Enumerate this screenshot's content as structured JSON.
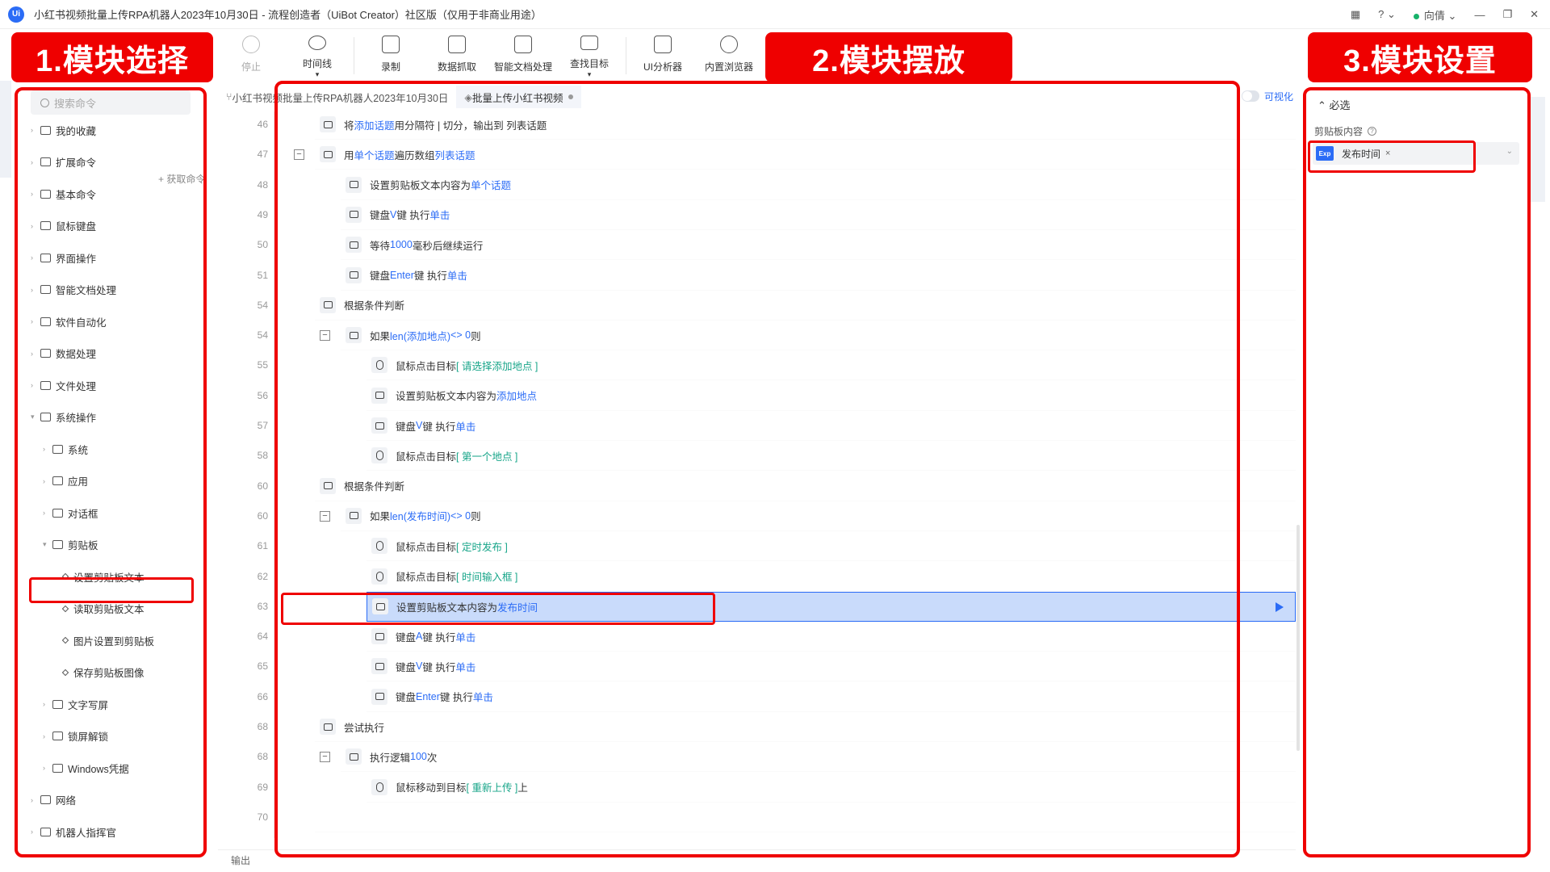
{
  "window": {
    "logo": "Ui",
    "title": "小红书视频批量上传RPA机器人2023年10月30日 - 流程创造者（UiBot Creator）社区版（仅用于非商业用途）",
    "user": "向倩"
  },
  "toolbar": [
    {
      "label": "停止",
      "icon": "stop-icon",
      "disabled": true
    },
    {
      "label": "时间线",
      "icon": "clock-icon",
      "dropdown": true
    },
    {
      "label": "录制",
      "icon": "record-icon"
    },
    {
      "label": "数据抓取",
      "icon": "data-grab-icon"
    },
    {
      "label": "智能文档处理",
      "icon": "ai-doc-icon"
    },
    {
      "label": "查找目标",
      "icon": "find-target-icon",
      "dropdown": true
    },
    {
      "label": "UI分析器",
      "icon": "ui-analyzer-icon"
    },
    {
      "label": "内置浏览器",
      "icon": "browser-icon"
    }
  ],
  "annotations": {
    "tag1": "1.模块选择",
    "tag2": "2.模块摆放",
    "tag3": "3.模块设置"
  },
  "left": {
    "search_placeholder": "搜索命令",
    "get_command": "+ 获取命令",
    "tree": [
      {
        "label": "我的收藏",
        "level": 0
      },
      {
        "label": "扩展命令",
        "level": 0
      },
      {
        "label": "基本命令",
        "level": 0
      },
      {
        "label": "鼠标键盘",
        "level": 0
      },
      {
        "label": "界面操作",
        "level": 0
      },
      {
        "label": "智能文档处理",
        "level": 0
      },
      {
        "label": "软件自动化",
        "level": 0
      },
      {
        "label": "数据处理",
        "level": 0
      },
      {
        "label": "文件处理",
        "level": 0
      },
      {
        "label": "系统操作",
        "level": 0,
        "expanded": true
      },
      {
        "label": "系统",
        "level": 1
      },
      {
        "label": "应用",
        "level": 1
      },
      {
        "label": "对话框",
        "level": 1
      },
      {
        "label": "剪贴板",
        "level": 1,
        "expanded": true
      },
      {
        "label": "设置剪贴板文本",
        "level": 2
      },
      {
        "label": "读取剪贴板文本",
        "level": 2
      },
      {
        "label": "图片设置到剪贴板",
        "level": 2
      },
      {
        "label": "保存剪贴板图像",
        "level": 2
      },
      {
        "label": "文字写屏",
        "level": 1
      },
      {
        "label": "锁屏解锁",
        "level": 1
      },
      {
        "label": "Windows凭据",
        "level": 1
      },
      {
        "label": "网络",
        "level": 0
      },
      {
        "label": "机器人指挥官",
        "level": 0
      }
    ]
  },
  "editor": {
    "tabs": [
      {
        "label": "小红书视频批量上传RPA机器人2023年10月30日"
      },
      {
        "label": "批量上传小红书视频",
        "active": true
      }
    ],
    "visual_toggle": "可视化",
    "output_label": "输出",
    "rows": [
      {
        "line": "46",
        "indent": 0,
        "segs": [
          [
            "将 ",
            ""
          ],
          [
            "添加话题",
            "kw"
          ],
          [
            " 用分隔符 | 切分，输出到 列表话题",
            ""
          ]
        ]
      },
      {
        "line": "47",
        "indent": 0,
        "fold": true,
        "segs": [
          [
            "用 ",
            ""
          ],
          [
            "单个话题",
            "kw"
          ],
          [
            " 遍历数组 ",
            ""
          ],
          [
            "列表话题",
            "kw"
          ]
        ]
      },
      {
        "line": "48",
        "indent": 1,
        "segs": [
          [
            "设置剪贴板文本内容为 ",
            ""
          ],
          [
            "单个话题",
            "kw"
          ]
        ]
      },
      {
        "line": "49",
        "indent": 1,
        "segs": [
          [
            "键盘 ",
            ""
          ],
          [
            "V",
            "kw"
          ],
          [
            " 键 执行 ",
            ""
          ],
          [
            "单击",
            "kw"
          ]
        ]
      },
      {
        "line": "50",
        "indent": 1,
        "segs": [
          [
            "等待 ",
            ""
          ],
          [
            "1000",
            "kw"
          ],
          [
            " 毫秒后继续运行",
            ""
          ]
        ]
      },
      {
        "line": "51",
        "indent": 1,
        "segs": [
          [
            "键盘 ",
            ""
          ],
          [
            "Enter",
            "kw"
          ],
          [
            " 键 执行 ",
            ""
          ],
          [
            "单击",
            "kw"
          ]
        ]
      },
      {
        "line": "54",
        "indent": 0,
        "segs": [
          [
            "根据条件判断",
            ""
          ]
        ]
      },
      {
        "line": "54",
        "indent": 1,
        "fold": true,
        "segs": [
          [
            "如果 ",
            ""
          ],
          [
            "len(添加地点)",
            "kw"
          ],
          [
            " <> 0 ",
            "kw"
          ],
          [
            "则",
            ""
          ]
        ]
      },
      {
        "line": "55",
        "indent": 2,
        "circle": true,
        "segs": [
          [
            "鼠标点击目标 ",
            ""
          ],
          [
            "[ 请选择添加地点 ]",
            "kg"
          ]
        ]
      },
      {
        "line": "56",
        "indent": 2,
        "segs": [
          [
            "设置剪贴板文本内容为 ",
            ""
          ],
          [
            "添加地点",
            "kw"
          ]
        ]
      },
      {
        "line": "57",
        "indent": 2,
        "segs": [
          [
            "键盘 ",
            ""
          ],
          [
            "V",
            "kw"
          ],
          [
            " 键 执行 ",
            ""
          ],
          [
            "单击",
            "kw"
          ]
        ]
      },
      {
        "line": "58",
        "indent": 2,
        "circle": true,
        "segs": [
          [
            "鼠标点击目标 ",
            ""
          ],
          [
            "[ 第一个地点 ]",
            "kg"
          ]
        ]
      },
      {
        "line": "60",
        "indent": 0,
        "segs": [
          [
            "根据条件判断",
            ""
          ]
        ]
      },
      {
        "line": "60",
        "indent": 1,
        "fold": true,
        "segs": [
          [
            "如果 ",
            ""
          ],
          [
            "len(发布时间)",
            "kw"
          ],
          [
            " <> 0 ",
            "kw"
          ],
          [
            "则",
            ""
          ]
        ]
      },
      {
        "line": "61",
        "indent": 2,
        "circle": true,
        "segs": [
          [
            "鼠标点击目标 ",
            ""
          ],
          [
            "[ 定时发布 ]",
            "kg"
          ]
        ]
      },
      {
        "line": "62",
        "indent": 2,
        "circle": true,
        "segs": [
          [
            "鼠标点击目标 ",
            ""
          ],
          [
            "[ 时间输入框 ]",
            "kg"
          ]
        ]
      },
      {
        "line": "63",
        "indent": 2,
        "highlight": true,
        "segs": [
          [
            "设置剪贴板文本内容为 ",
            ""
          ],
          [
            "发布时间",
            "kw"
          ]
        ]
      },
      {
        "line": "64",
        "indent": 2,
        "segs": [
          [
            "键盘 ",
            ""
          ],
          [
            "A",
            "kw"
          ],
          [
            " 键 执行 ",
            ""
          ],
          [
            "单击",
            "kw"
          ]
        ]
      },
      {
        "line": "65",
        "indent": 2,
        "segs": [
          [
            "键盘 ",
            ""
          ],
          [
            "V",
            "kw"
          ],
          [
            " 键 执行 ",
            ""
          ],
          [
            "单击",
            "kw"
          ]
        ]
      },
      {
        "line": "66",
        "indent": 2,
        "segs": [
          [
            "键盘 ",
            ""
          ],
          [
            "Enter",
            "kw"
          ],
          [
            " 键 执行 ",
            ""
          ],
          [
            "单击",
            "kw"
          ]
        ]
      },
      {
        "line": "68",
        "indent": 0,
        "segs": [
          [
            "尝试执行",
            ""
          ]
        ]
      },
      {
        "line": "68",
        "indent": 1,
        "fold": true,
        "segs": [
          [
            "执行逻辑 ",
            ""
          ],
          [
            "100",
            "kw"
          ],
          [
            " 次",
            ""
          ]
        ]
      },
      {
        "line": "69",
        "indent": 2,
        "circle": true,
        "segs": [
          [
            "鼠标移动到目标 ",
            ""
          ],
          [
            "[ 重新上传 ]",
            "kg"
          ],
          [
            " 上",
            ""
          ]
        ]
      },
      {
        "line": "70",
        "indent": 0,
        "empty": true,
        "segs": []
      }
    ]
  },
  "right": {
    "section": "必选",
    "field_label": "剪贴板内容",
    "exp_badge": "Exp",
    "field_value": "发布时间",
    "field_clear": "×"
  },
  "colors": {
    "accent": "#2b6cf6",
    "annotation_red": "#ef0000",
    "target_green": "#17a589",
    "highlight_row": "#c9dbfb"
  }
}
